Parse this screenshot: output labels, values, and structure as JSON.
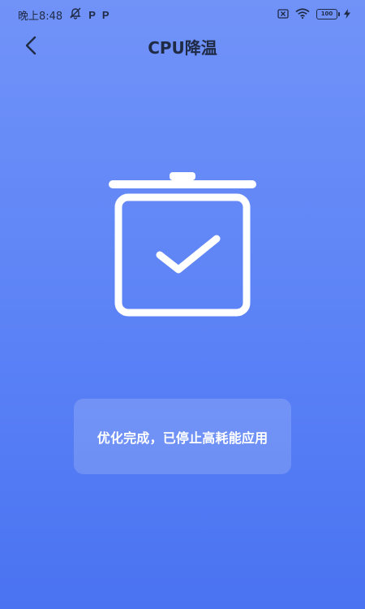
{
  "status_bar": {
    "time": "晚上8:48",
    "left_icons": [
      "bell-off-icon",
      "p-icon",
      "p-icon"
    ],
    "p_label": "P",
    "right_icons": [
      "sim-off-icon",
      "wifi-icon",
      "battery-icon",
      "charging-icon"
    ],
    "battery_label": "100"
  },
  "header": {
    "title": "CPU降温",
    "back_icon": "chevron-left-icon"
  },
  "illustration": {
    "icon": "trash-check-icon"
  },
  "message": {
    "text": "优化完成，已停止高耗能应用"
  },
  "colors": {
    "background_top": "#7193f8",
    "background_bottom": "#4a73f2",
    "title": "#1f2a44",
    "icon_stroke": "#ffffff"
  }
}
